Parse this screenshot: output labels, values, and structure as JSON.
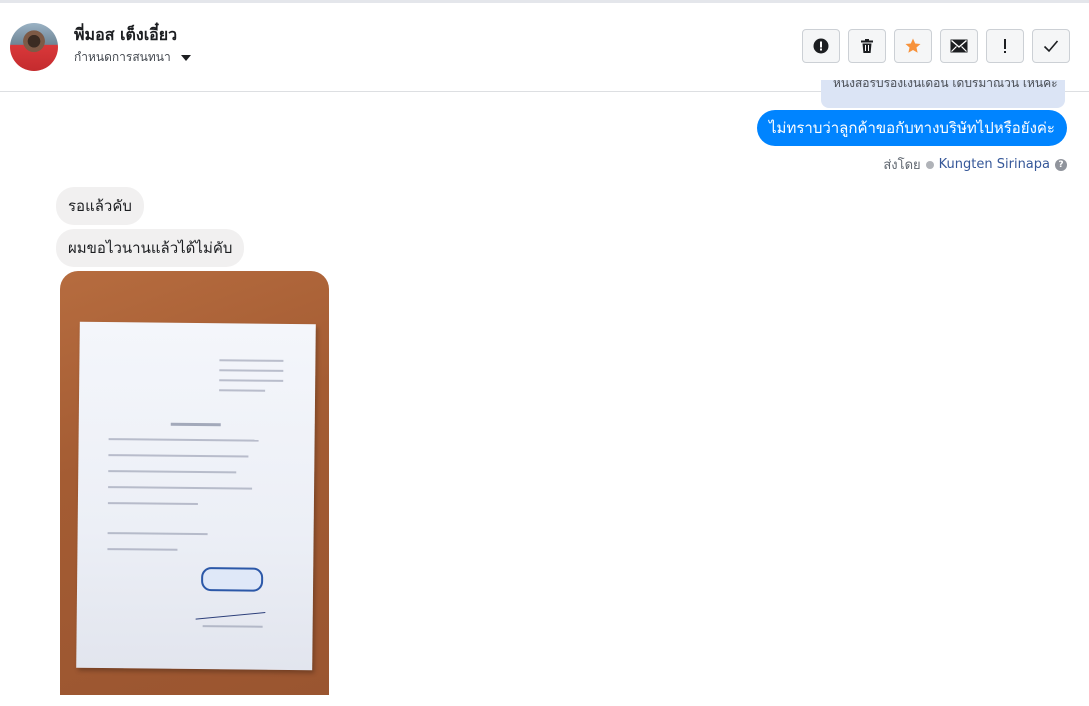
{
  "header": {
    "contact_name": "พี่มอส เต็งเอี๋ยว",
    "subtitle": "กำหนดการสนทนา"
  },
  "toolbar": {
    "buttons": [
      {
        "icon": "alert-circle-icon"
      },
      {
        "icon": "trash-icon"
      },
      {
        "icon": "star-icon",
        "color": "#f7923b"
      },
      {
        "icon": "envelope-icon"
      },
      {
        "icon": "exclamation-icon"
      },
      {
        "icon": "check-icon"
      }
    ]
  },
  "messages": {
    "cut_off_text": "หนังสือรับรองเงินเดือน เดปรมาณวน เหนคะ",
    "outgoing_text": "ไม่ทราบว่าลูกค้าขอกับทางบริษัทไปหรือยังค่ะ",
    "sent_by_label": "ส่งโดย",
    "sent_by_name": "Kungten Sirinapa",
    "incoming_1": "รอแล้วคับ",
    "incoming_2": "ผมขอไวนานแล้วได้ไม่คับ"
  },
  "colors": {
    "outgoing_bubble": "#0084ff",
    "incoming_bubble": "#f1f0f0",
    "link": "#365899"
  }
}
